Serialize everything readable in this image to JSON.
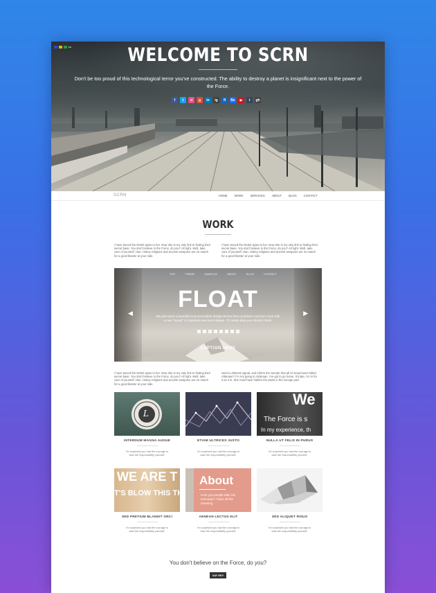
{
  "hero": {
    "flags": [
      {
        "name": "flag-france",
        "color": "#2a4bd1"
      },
      {
        "name": "flag-germany",
        "color": "#e2b318"
      },
      {
        "name": "flag-italy",
        "color": "#2e9b3a"
      }
    ],
    "flags_label": "EN",
    "title": "WELCOME TO SCRN",
    "text": "Don't be too proud of this technological terror you've constructed. The ability to destroy a planet is insignificant next to the power of the Force.",
    "social": [
      {
        "icon": "facebook-icon",
        "glyph": "f",
        "color": "#3b5998"
      },
      {
        "icon": "twitter-icon",
        "glyph": "t",
        "color": "#1da1f2"
      },
      {
        "icon": "dribbble-icon",
        "glyph": "d",
        "color": "#ea4c89"
      },
      {
        "icon": "google-plus-icon",
        "glyph": "g",
        "color": "#dd4b39"
      },
      {
        "icon": "linkedin-icon",
        "glyph": "in",
        "color": "#0077b5"
      },
      {
        "icon": "instagram-icon",
        "glyph": "ig",
        "color": "#3f3f3f"
      },
      {
        "icon": "flickr-icon",
        "glyph": "fl",
        "color": "#1565c0"
      },
      {
        "icon": "behance-icon",
        "glyph": "Be",
        "color": "#1769ff"
      },
      {
        "icon": "youtube-icon",
        "glyph": "▶",
        "color": "#cc181e"
      },
      {
        "icon": "tumblr-icon",
        "glyph": "t",
        "color": "#35465c"
      },
      {
        "icon": "github-icon",
        "glyph": "gh",
        "color": "#444444"
      }
    ]
  },
  "nav": {
    "logo": "SCRN",
    "items": [
      "HOME",
      "WORK",
      "SERVICES",
      "ABOUT",
      "BLOG",
      "CONTACT"
    ]
  },
  "work": {
    "title": "WORK",
    "para_left": "I have traced the Rebel spies to her. Now she is my only link to finding their secret base. You don't believe in the Force, do you? All right. Well, take care of yourself, Han. Hokey religions and ancient weapons are no match for a good blaster at your side.",
    "para_right": "I have traced the Rebel spies to her. Now she is my only link to finding their secret base. You don't believe in the Force, do you? All right. Well, take care of yourself, Han. Hokey religions and ancient weapons are no match for a good blaster at your side.",
    "slider": {
      "menu": [
        "TOP",
        "THEME",
        "SAMPLES",
        "ABOUT",
        "BLOG",
        "CONTACT"
      ],
      "title": "FLOAT",
      "text": "We just need a beautiful and accessible design theme that combines common nook with a new \"mood\" of classical user-level design. I'll create data you should check.",
      "caption": "CAPTION HERE"
    },
    "para2_left": "I have traced the Rebel spies to her. Now she is my only link to finding their secret base. You don't believe in the Force, do you? All right. Well, take care of yourself, Han. Hokey religions and ancient weapons are no match for a good blaster at your side.",
    "para2_right": "Send a distress signal, and inform the Senate that all on board were killed. Alderaan? I'm not going to Alderaan. I've got to go home. It's late, I'm in for it as it is. She must have hidden the plans in the escape pod.",
    "cards": [
      {
        "title": "INTERDUM MAGNA AUGUE",
        "text": "I'm surprised you had the courage to take the responsibility yourself."
      },
      {
        "title": "ETIAM ULTRICES JUSTO",
        "text": "I'm surprised you had the courage to take the responsibility yourself."
      },
      {
        "title": "NULLA UT FELIS IN PURUS",
        "text": "I'm surprised you had the courage to take the responsibility yourself."
      },
      {
        "title": "SED PRETIUM BLANDIT ORCI",
        "text": "I'm surprised you had the courage to take the responsibility yourself."
      },
      {
        "title": "AENEAN LECTUS ELIT",
        "text": "I'm surprised you had the courage to take the responsibility yourself."
      },
      {
        "title": "SED ALIQUET RISUS",
        "text": "I'm surprised you had the courage to take the responsibility yourself."
      }
    ],
    "thumb_texts": {
      "badge": "L",
      "we_big": "We",
      "we_line1": "The Force is s",
      "we_line2": "In my experience, th",
      "weare_line1": "WE ARE T",
      "weare_line2": "T'S BLOW THIS THI",
      "about_title": "About",
      "about_text": "Cent you people take me seriously? I have all the meaning."
    }
  },
  "footer": {
    "question": "You don't believe on the Force, do you?",
    "button": "SAY HEY"
  }
}
